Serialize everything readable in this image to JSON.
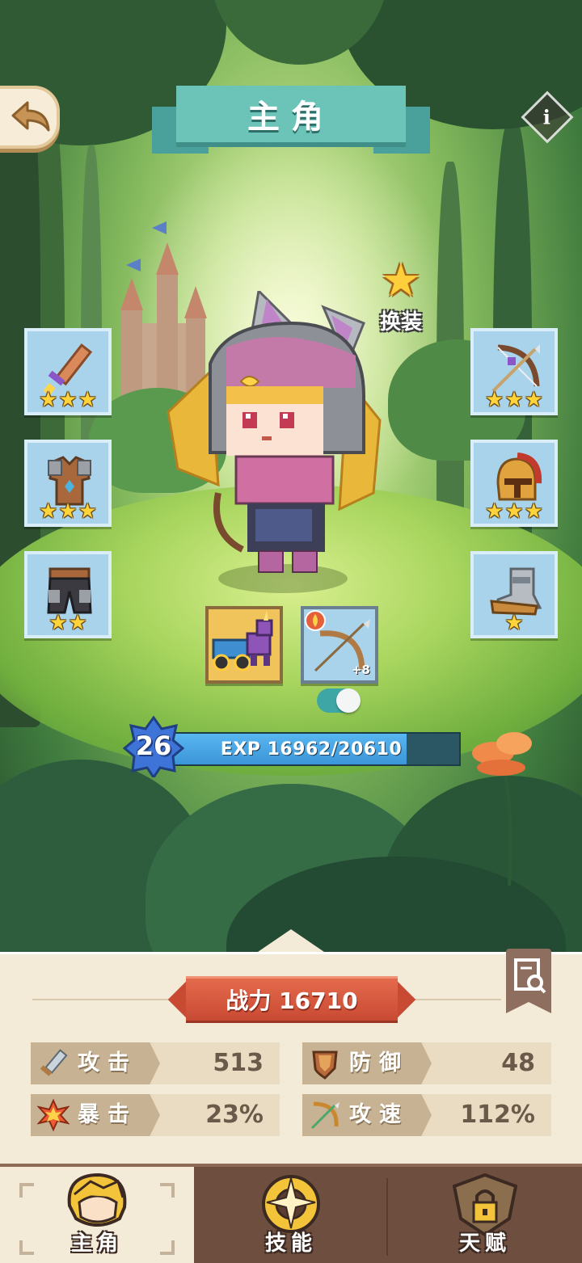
{
  "title": "主角",
  "change_outfit_label": "换装",
  "equipment": {
    "left": [
      {
        "slot": "weapon",
        "icon": "sword-icon",
        "stars": 3
      },
      {
        "slot": "armor",
        "icon": "armor-icon",
        "stars": 3
      },
      {
        "slot": "pants",
        "icon": "pants-icon",
        "stars": 2
      }
    ],
    "right": [
      {
        "slot": "bow",
        "icon": "bow-icon",
        "stars": 3
      },
      {
        "slot": "helmet",
        "icon": "helmet-icon",
        "stars": 3
      },
      {
        "slot": "boots",
        "icon": "boots-icon",
        "stars": 1
      }
    ]
  },
  "pet_card": {
    "icon": "unicorn-cart-icon"
  },
  "weapon_card": {
    "icon": "fire-bow-icon",
    "bonus": "+8"
  },
  "toggle_on": true,
  "level": "26",
  "exp": {
    "text": "EXP 16962/20610",
    "current": 16962,
    "max": 20610
  },
  "power": {
    "text": "战力 16710"
  },
  "stats": [
    {
      "label": "攻击",
      "value": "513",
      "icon": "sword-icon"
    },
    {
      "label": "防御",
      "value": "48",
      "icon": "shield-icon"
    },
    {
      "label": "暴击",
      "value": "23%",
      "icon": "explosion-icon"
    },
    {
      "label": "攻速",
      "value": "112%",
      "icon": "bow-arrow-icon"
    }
  ],
  "nav": [
    {
      "label": "主角",
      "icon": "hero-head-icon",
      "active": true
    },
    {
      "label": "技能",
      "icon": "skill-swirl-icon",
      "active": false
    },
    {
      "label": "天赋",
      "icon": "locked-talent-icon",
      "active": false
    }
  ],
  "colors": {
    "accent_teal": "#6cc3b7",
    "power_red": "#d4553b",
    "panel_bg": "#f3ead8",
    "nav_bg": "#6e4e3e",
    "exp_blue": "#4aa5e4"
  }
}
